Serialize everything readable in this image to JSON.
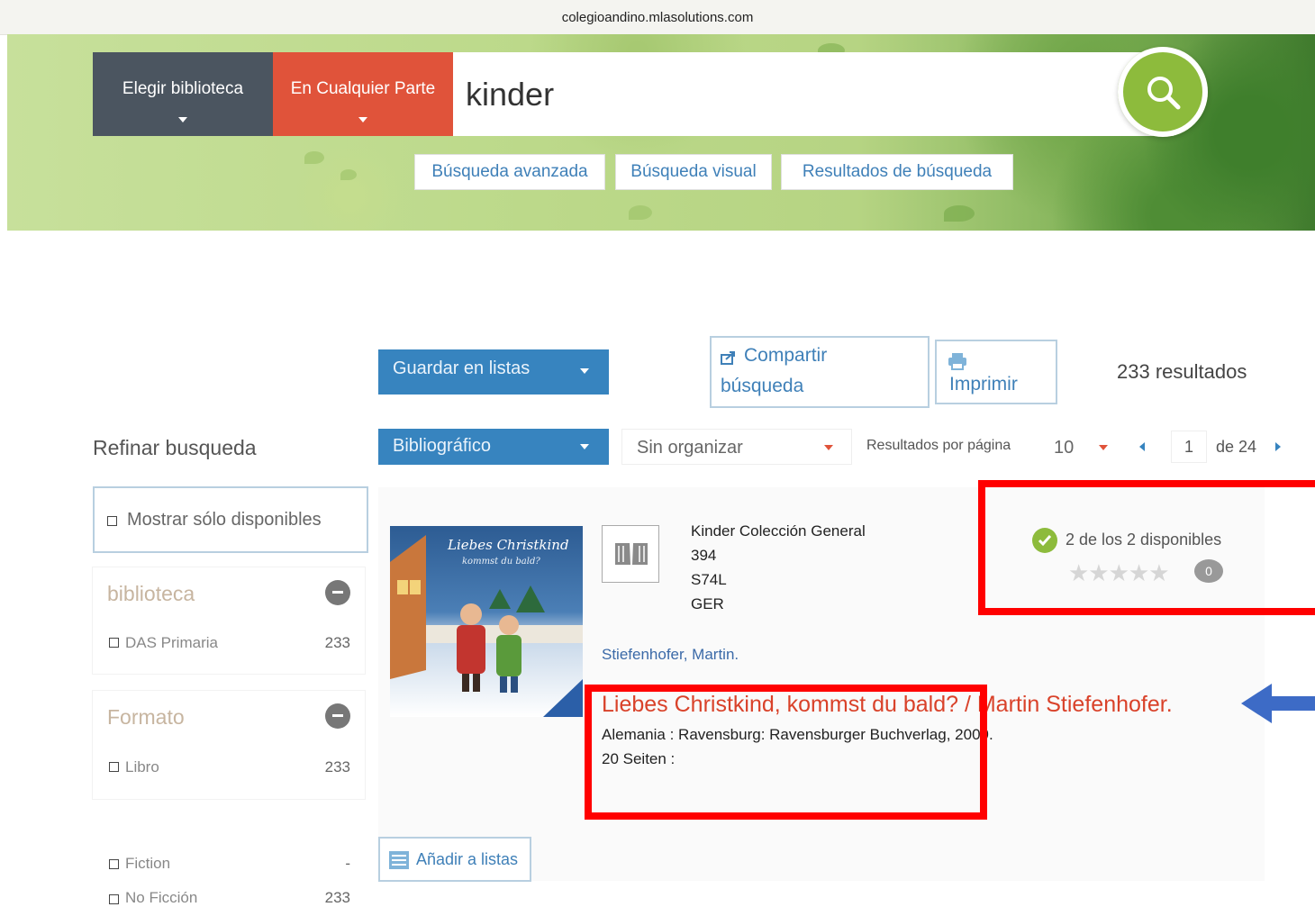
{
  "browser": {
    "url": "colegioandino.mlasolutions.com"
  },
  "search": {
    "library_label": "Elegir biblioteca",
    "scope_label": "En Cualquier Parte",
    "query": "kinder",
    "links": [
      "Búsqueda avanzada",
      "Búsqueda visual",
      "Resultados de búsqueda"
    ]
  },
  "toolbar": {
    "save_lists": "Guardar en listas",
    "share_line1": "Compartir",
    "share_line2": "búsqueda",
    "print": "Imprimir",
    "results_count": "233 resultados",
    "format": "Bibliográfico",
    "sort": "Sin organizar",
    "per_page_label": "Resultados por página",
    "per_page": "10",
    "page": "1",
    "page_total": "de 24"
  },
  "sidebar": {
    "title": "Refinar busqueda",
    "only_available": "Mostrar sólo disponibles",
    "facets": [
      {
        "title": "biblioteca",
        "items": [
          {
            "label": "DAS Primaria",
            "count": "233"
          }
        ]
      },
      {
        "title": "Formato",
        "items": [
          {
            "label": "Libro",
            "count": "233"
          }
        ]
      }
    ],
    "extra_items": [
      {
        "label": "Fiction",
        "count": "-"
      },
      {
        "label": "No Ficción",
        "count": "233"
      }
    ]
  },
  "result": {
    "cover_title": "Liebes Christkind",
    "cover_subtitle": "kommst du bald?",
    "call_number": [
      "Kinder Colección General",
      "394",
      "S74L",
      "GER"
    ],
    "author": "Stiefenhofer, Martin.",
    "title": "Liebes Christkind, kommst du bald? / Martin Stiefenhofer.",
    "publication": "Alemania : Ravensburg: Ravensburger Buchverlag, 2009.",
    "pages": "20 Seiten :",
    "availability": "2 de los 2 disponibles",
    "comments": "0",
    "rating": 0,
    "add_to_lists": "Añadir a listas"
  },
  "colors": {
    "accent_blue": "#3784bf",
    "accent_red": "#e0533a",
    "search_green": "#8dbb3c"
  }
}
